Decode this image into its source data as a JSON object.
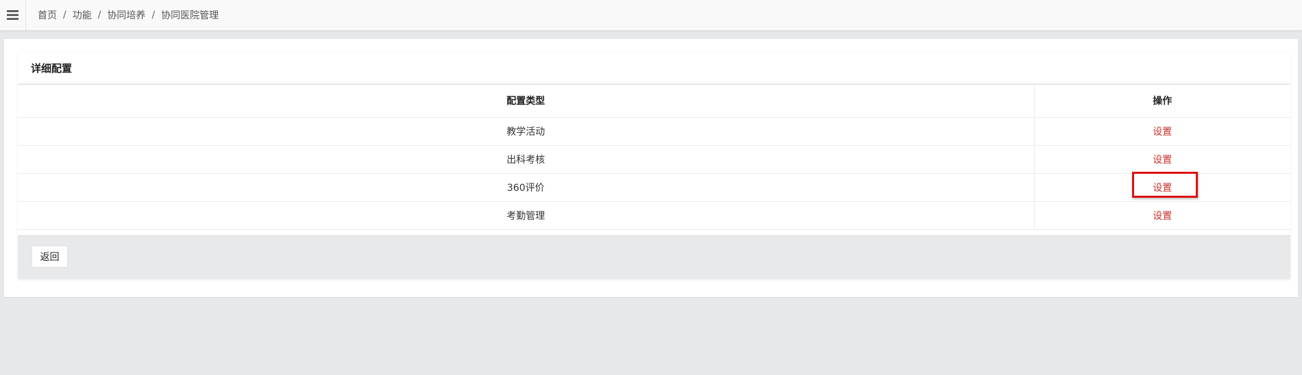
{
  "breadcrumb": {
    "items": [
      "首页",
      "功能",
      "协同培养",
      "协同医院管理"
    ],
    "separator": "/"
  },
  "icons": {
    "menu": "hamburger-menu-icon"
  },
  "card": {
    "title": "详细配置"
  },
  "table": {
    "headers": [
      "配置类型",
      "操作"
    ],
    "rows": [
      {
        "type": "教学活动",
        "action": "设置"
      },
      {
        "type": "出科考核",
        "action": "设置"
      },
      {
        "type": "360评价",
        "action": "设置"
      },
      {
        "type": "考勤管理",
        "action": "设置"
      }
    ]
  },
  "footer": {
    "back_label": "返回"
  },
  "colors": {
    "link": "#c9302c",
    "highlight": "#dd1111",
    "background": "#e7e8ea"
  }
}
